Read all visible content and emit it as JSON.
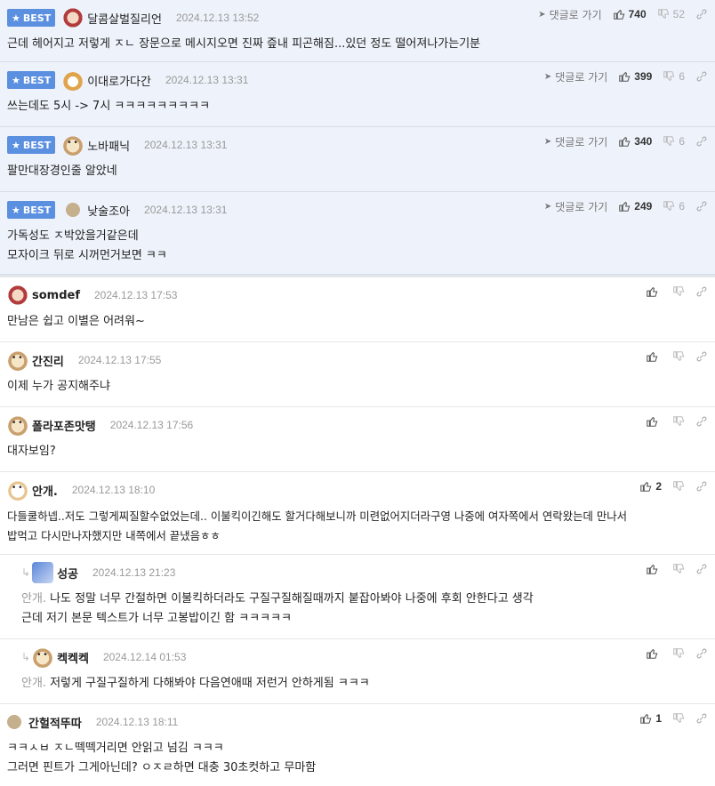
{
  "best_label": "BEST",
  "goto_label": "댓글로 가기",
  "best_comments": [
    {
      "nick": "달콤살벌질리언",
      "date": "2024.12.13 13:52",
      "likes": "740",
      "dislikes": "52",
      "lines": [
        "근데 헤어지고 저렇게 ㅈㄴ 장문으로 메시지오면 진짜 즢내 피곤해짐...있던 정도 떨어져나가는기분"
      ]
    },
    {
      "nick": "이대로가다간",
      "date": "2024.12.13 13:31",
      "likes": "399",
      "dislikes": "6",
      "lines": [
        "쓰는데도 5시 -> 7시 ㅋㅋㅋㅋㅋㅋㅋㅋㅋ"
      ]
    },
    {
      "nick": "노바패닉",
      "date": "2024.12.13 13:31",
      "likes": "340",
      "dislikes": "6",
      "lines": [
        "팔만대장경인줄 알았네"
      ]
    },
    {
      "nick": "낮술조아",
      "date": "2024.12.13 13:31",
      "likes": "249",
      "dislikes": "6",
      "lines": [
        "가독성도 ㅈ박았을거같은데",
        "모자이크 뒤로 시꺼먼거보면 ㅋㅋ"
      ]
    }
  ],
  "comments": [
    {
      "nick": "somdef",
      "date": "2024.12.13 17:53",
      "likes": "",
      "lines": [
        "만남은 쉽고 이별은 어려워~"
      ]
    },
    {
      "nick": "간진리",
      "date": "2024.12.13 17:55",
      "likes": "",
      "lines": [
        "이제 누가 공지해주냐"
      ]
    },
    {
      "nick": "폴라포존맛탱",
      "date": "2024.12.13 17:56",
      "likes": "",
      "lines": [
        "대자보임?"
      ]
    },
    {
      "nick": "안개.",
      "date": "2024.12.13 18:10",
      "likes": "2",
      "lines": [
        "다들쿨하넵..저도 그렇게찌질할수없었는데.. 이불킥이긴해도 할거다해보니까 미련없어지더라구영 나중에 여자쪽에서 연락왔는데 만나서",
        "밥먹고 다시만나자했지만 내쪽에서 끝냈음ㅎㅎ"
      ]
    },
    {
      "nick": "성공",
      "date": "2024.12.13 21:23",
      "likes": "",
      "mention": "안개.",
      "lines": [
        "나도 정말 너무 간절하면 이불킥하더라도 구질구질해질때까지 붙잡아봐야 나중에 후회 안한다고 생각",
        "근데 저기 본문 텍스트가 너무 고봉밥이긴 함 ㅋㅋㅋㅋㅋ"
      ]
    },
    {
      "nick": "켁켁켁",
      "date": "2024.12.14 01:53",
      "likes": "",
      "mention": "안개.",
      "lines": [
        "저렇게 구질구질하게 다해봐야 다음연애때 저런거 안하게됨 ㅋㅋㅋ"
      ]
    },
    {
      "nick": "간헐적뚜따",
      "date": "2024.12.13 18:11",
      "likes": "1",
      "lines": [
        "ㅋㅋㅅㅂ ㅈㄴ떽떽거리면 안읽고 넘김 ㅋㅋㅋ",
        "그러면 핀트가 그게아닌데? ㅇㅈㄹ하면 대충 30초컷하고 무마함"
      ]
    }
  ]
}
